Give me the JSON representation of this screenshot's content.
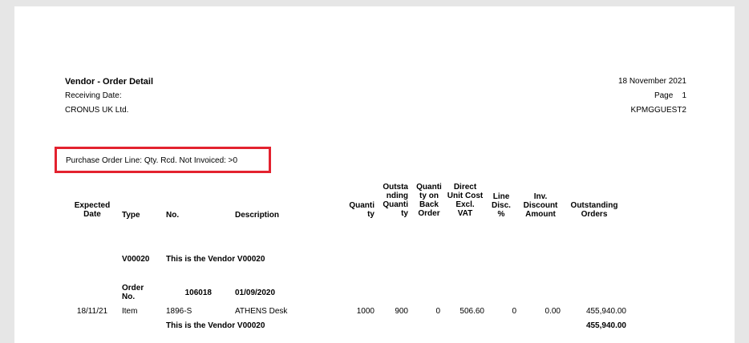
{
  "report": {
    "title": "Vendor - Order Detail",
    "receiving_date_label": "Receiving Date:",
    "company": "CRONUS UK Ltd.",
    "date": "18 November 2021",
    "page_label": "Page",
    "page_number": "1",
    "user": "KPMGGUEST2",
    "filter": "Purchase Order Line: Qty. Rcd. Not Invoiced: >0",
    "highlight_color": "#e3222f"
  },
  "columns": {
    "expected_date_1": "Expected",
    "expected_date_2": "Date",
    "type": "Type",
    "no": "No.",
    "description": "Description",
    "quantity_1": "Quanti",
    "quantity_2": "ty",
    "outstanding_qty_1": "Outsta",
    "outstanding_qty_2": "nding",
    "outstanding_qty_3": "Quanti",
    "outstanding_qty_4": "ty",
    "qty_back_order_1": "Quanti",
    "qty_back_order_2": "ty on",
    "qty_back_order_3": "Back",
    "qty_back_order_4": "Order",
    "direct_unit_cost_1": "Direct",
    "direct_unit_cost_2": "Unit Cost",
    "direct_unit_cost_3": "Excl.",
    "direct_unit_cost_4": "VAT",
    "line_disc_1": "Line",
    "line_disc_2": "Disc.",
    "line_disc_3": "%",
    "inv_discount_1": "Inv.",
    "inv_discount_2": "Discount",
    "inv_discount_3": "Amount",
    "outstanding_orders_1": "Outstanding",
    "outstanding_orders_2": "Orders"
  },
  "vendor": {
    "no": "V00020",
    "name": "This is the Vendor V00020"
  },
  "order": {
    "label_1": "Order",
    "label_2": "No.",
    "number": "106018",
    "date": "01/09/2020"
  },
  "line": {
    "expected_date": "18/11/21",
    "type": "Item",
    "no": "1896-S",
    "description": "ATHENS Desk",
    "quantity": "1000",
    "outstanding_qty": "900",
    "qty_back_order": "0",
    "direct_unit_cost": "506.60",
    "line_disc": "0",
    "inv_discount": "0.00",
    "outstanding_orders": "455,940.00"
  },
  "total": {
    "label": "This is the Vendor V00020",
    "amount": "455,940.00"
  }
}
